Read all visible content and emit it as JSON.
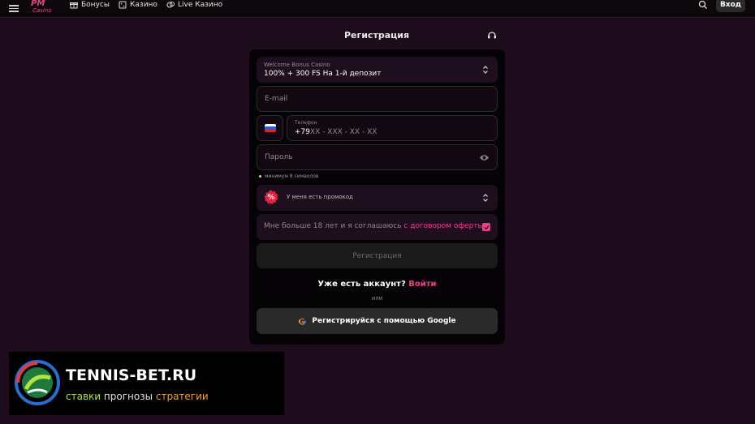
{
  "nav": {
    "logo_text": "PM Casino",
    "items": [
      {
        "label": "Бонусы",
        "icon": "gift-icon"
      },
      {
        "label": "Казино",
        "icon": "casino-icon"
      },
      {
        "label": "Live Казино",
        "icon": "live-icon"
      }
    ],
    "login_label": "Вход"
  },
  "modal": {
    "title": "Регистрация",
    "bonus": {
      "caption": "Welcome Bonus Casino",
      "value": "100% + 300 FS На 1-й депозит"
    },
    "email": {
      "placeholder": "E-mail"
    },
    "phone": {
      "label": "Телефон",
      "prefix": "+79",
      "mask": "XX - XXX - XX - XX"
    },
    "password": {
      "placeholder": "Пароль"
    },
    "password_hint": "минимум 8 символов",
    "promo": {
      "label": "У меня есть промокод"
    },
    "terms": {
      "text": "Мне больше 18 лет и я соглашаюсь ",
      "link": "с договором оферты",
      "checked": true
    },
    "submit_label": "Регистрация",
    "have_account": "Уже есть аккаунт?",
    "login_link": "Войти",
    "or_label": "или",
    "google_label": "Регистрируйся с помощью Google"
  },
  "watermark": {
    "title": "TENNIS-BET.RU",
    "sub_1": "ставки",
    "sub_2": "прогнозы",
    "sub_3": "стратегии"
  },
  "colors": {
    "background": "#1c0c1c",
    "accent": "#e8428a",
    "card": "#050305",
    "field": "#1e0f1e"
  }
}
